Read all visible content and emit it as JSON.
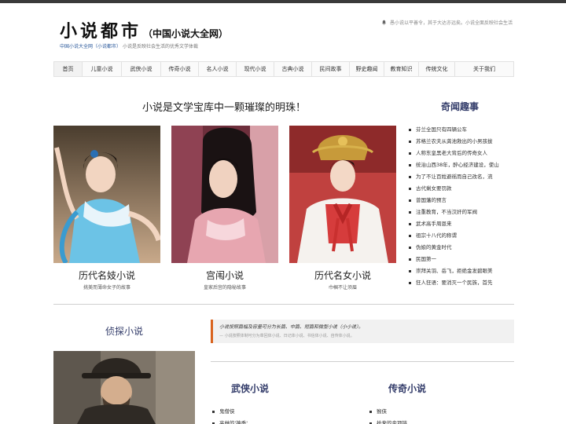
{
  "header": {
    "logo_main": "小说都市",
    "logo_sub": "（中国小说大全网）",
    "tagline_link": "中国小说大全网（小说都市）",
    "tagline_text": "小说是反映社会生活的优秀文学体裁",
    "notice_icon": "bell-icon",
    "notice": "愚小说以平善令，其于大达亦远矣。小说全面反映社会生活"
  },
  "nav": {
    "items": [
      "首页",
      "儿童小说",
      "武侠小说",
      "传奇小说",
      "名人小说",
      "现代小说",
      "古典小说",
      "民间故事",
      "野史趣闻",
      "教育知识",
      "传统文化",
      "关于我们"
    ]
  },
  "main": {
    "headline": "小说是文学宝库中一颗璀璨的明珠！",
    "cards": [
      {
        "title": "历代名妓小说",
        "desc": "挑美而薄命女子的故事"
      },
      {
        "title": "宫闱小说",
        "desc": "皇家后宫的隐秘故事"
      },
      {
        "title": "历代名女小说",
        "desc": "巾帼不让须眉"
      }
    ]
  },
  "sidebar": {
    "title": "奇闻趣事",
    "items": [
      "芬兰全国只有四辆公车",
      "苏格兰农夫从龚池救出的小男孩拔",
      "人称东皇黑老大背后的传奇女人",
      "统治山西38年，醉心经济建设，使山",
      "为了不让百姓避徭而自己改名，流",
      "古代剩女要罚款",
      "曾国藩的预言",
      "注重教育，不当汉奸的军阀",
      "武术高手周恩来",
      "祖宗十八代的称谓",
      "伪娘的黄金时代",
      "民国第一",
      "崇拜关羽、岳飞，拒绝金发碧眼美",
      "狂人狂语：要消灭一个民族，首先"
    ]
  },
  "detective": {
    "title": "侦探小说"
  },
  "quote": {
    "main": "小说按照篇幅及容量可分为长篇、中篇、短篇和微型小说（小小说）。",
    "sub": "— 小说按照体制可分为章回体小说、日记体小说、书信体小说、自传体小说。"
  },
  "categories": [
    {
      "title": "武侠小说",
      "items": [
        "鬼僧侠",
        "高林的'神秃'"
      ]
    },
    {
      "title": "传奇小说",
      "items": [
        "猴侠",
        "抢来的金项链"
      ]
    }
  ],
  "colors": {
    "accent_blue": "#333c6a",
    "link_blue": "#2c5a9c",
    "quote_border": "#d9631e"
  }
}
